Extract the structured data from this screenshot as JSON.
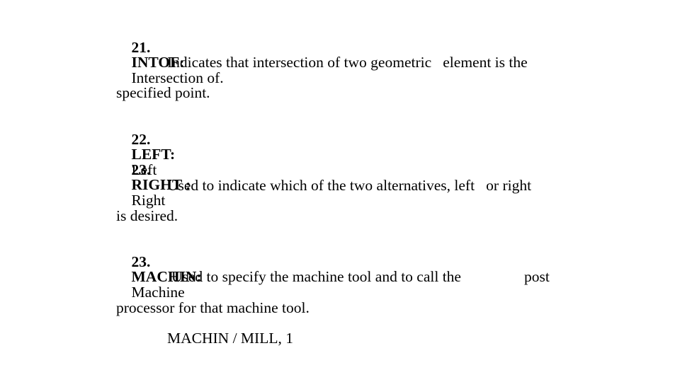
{
  "slide": {
    "items": [
      {
        "number": "21.",
        "keyword": "INTOF:",
        "meaning": "Intersection of."
      },
      {
        "number": "22.",
        "keyword": "LEFT:",
        "meaning": "Left"
      },
      {
        "number": "23.",
        "keyword": "RIGHT :",
        "meaning": "Right"
      },
      {
        "number": "23.",
        "keyword": "MACHIN:",
        "meaning": "Machine"
      }
    ],
    "desc_intof_1": "Indicates that intersection of two geometric   element is the",
    "desc_intof_2": "specified point.",
    "desc_leftright_1": "Used to indicate which of the two alternatives, left   or right",
    "desc_leftright_2": "is desired.",
    "desc_machin_1a": "Used to specify the machine tool and to call the",
    "desc_machin_1b": "post",
    "desc_machin_2": "processor for that machine tool.",
    "example_machin": "MACHIN / MILL, 1"
  }
}
